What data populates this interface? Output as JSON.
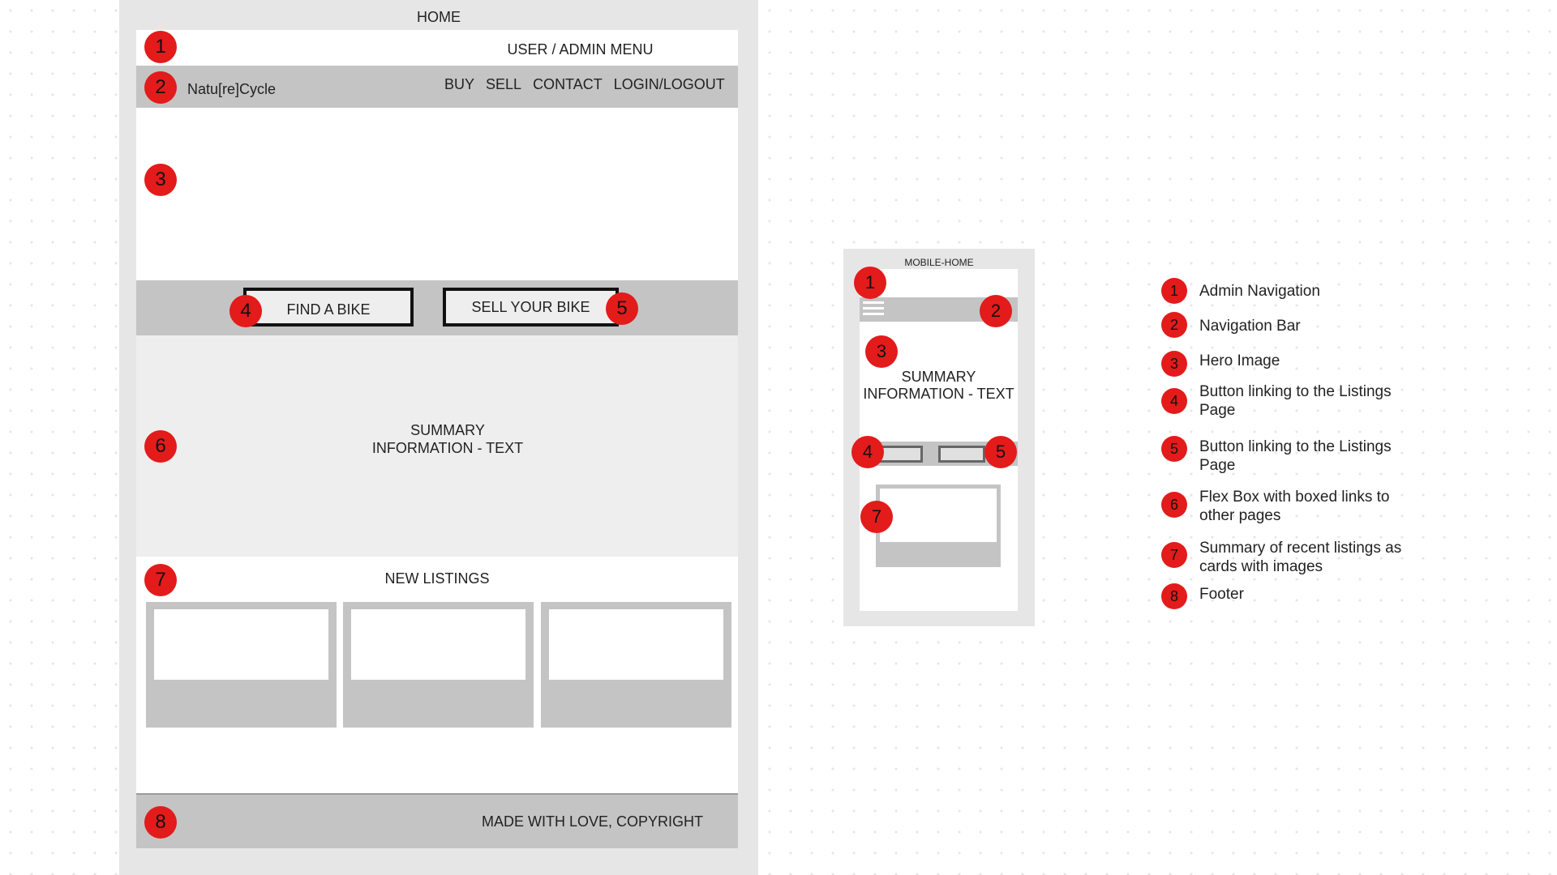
{
  "desktop": {
    "title": "HOME",
    "admin_menu": "USER / ADMIN MENU",
    "brand": "Natu[re]Cycle",
    "nav": [
      "BUY",
      "SELL",
      "CONTACT",
      "LOGIN/LOGOUT"
    ],
    "find_button": "FIND A BIKE",
    "sell_button": "SELL YOUR BIKE",
    "summary_line1": "SUMMARY",
    "summary_line2": "INFORMATION - TEXT",
    "listings_title": "NEW LISTINGS",
    "footer": "MADE WITH LOVE, COPYRIGHT"
  },
  "mobile": {
    "title": "MOBILE-HOME",
    "summary_line1": "SUMMARY",
    "summary_line2": "INFORMATION - TEXT"
  },
  "markers": [
    "1",
    "2",
    "3",
    "4",
    "5",
    "6",
    "7",
    "8"
  ],
  "legend": [
    {
      "num": "1",
      "text": "Admin Navigation"
    },
    {
      "num": "2",
      "text": "Navigation Bar"
    },
    {
      "num": "3",
      "text": "Hero Image"
    },
    {
      "num": "4",
      "text": "Button linking to the Listings Page"
    },
    {
      "num": "5",
      "text": "Button linking to the Listings Page"
    },
    {
      "num": "6",
      "text": "Flex Box with boxed links to other pages"
    },
    {
      "num": "7",
      "text": "Summary of recent listings as cards with images"
    },
    {
      "num": "8",
      "text": "Footer"
    }
  ],
  "colors": {
    "marker": "#e31b1b",
    "frame": "#e6e6e6",
    "block": "#c4c4c4",
    "light_block": "#eeeeee"
  }
}
